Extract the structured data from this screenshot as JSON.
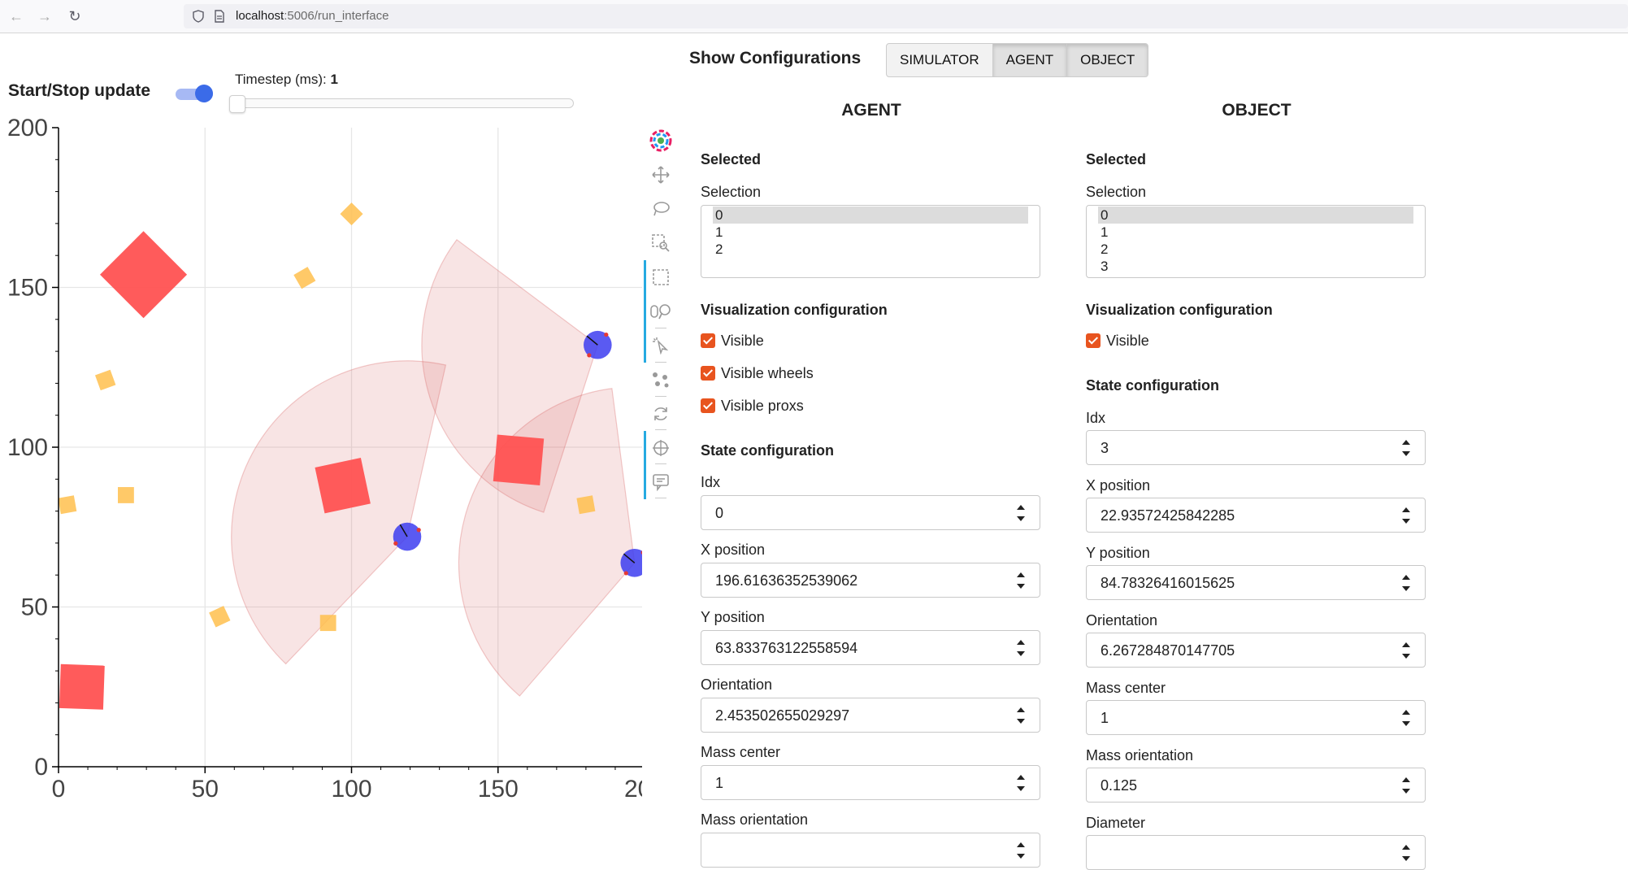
{
  "browser": {
    "url_host": "localhost",
    "url_path": ":5006/run_interface"
  },
  "controls": {
    "toggle_label": "Start/Stop update",
    "toggle_on": true,
    "timestep_label": "Timestep (ms): ",
    "timestep_value": "1",
    "timestep_slider_fraction": 0
  },
  "plot": {
    "x_ticks": [
      "0",
      "50",
      "100",
      "150",
      "200"
    ],
    "y_ticks": [
      "0",
      "50",
      "100",
      "150",
      "200"
    ],
    "xlim": [
      0,
      200
    ],
    "ylim": [
      0,
      200
    ],
    "grid": true,
    "colors": {
      "object": "#ff5252",
      "resource": "#ffc04d",
      "agent": "#3d3df0",
      "prox": "#d96b6b"
    },
    "objects": [
      {
        "x": 29,
        "y": 154,
        "size": 21,
        "angle": 45
      },
      {
        "x": 97,
        "y": 88,
        "size": 16,
        "angle": 12
      },
      {
        "x": 157,
        "y": 96,
        "size": 16,
        "angle": -5
      },
      {
        "x": 8,
        "y": 25,
        "size": 15,
        "angle": -2
      }
    ],
    "resources": [
      {
        "x": 100,
        "y": 173,
        "angle": 45
      },
      {
        "x": 84,
        "y": 153,
        "angle": 30
      },
      {
        "x": 16,
        "y": 121,
        "angle": 20
      },
      {
        "x": 3,
        "y": 82,
        "angle": 10
      },
      {
        "x": 23,
        "y": 85,
        "angle": 0
      },
      {
        "x": 55,
        "y": 47,
        "angle": 25
      },
      {
        "x": 92,
        "y": 45,
        "angle": 0
      },
      {
        "x": 180,
        "y": 82,
        "angle": 10
      }
    ],
    "agents": [
      {
        "x": 119,
        "y": 72,
        "orientation": 2.1,
        "fov": [
          1.35,
          3.95
        ]
      },
      {
        "x": 184,
        "y": 132,
        "orientation": 2.45,
        "fov": [
          2.5,
          4.4
        ]
      },
      {
        "x": 196.6,
        "y": 63.8,
        "orientation": 2.45,
        "fov": [
          1.7,
          4.0
        ]
      }
    ]
  },
  "toolbar": {
    "tools": [
      "bokeh-logo-icon",
      "pan-icon",
      "lasso-select-icon",
      "box-zoom-icon",
      "box-select-icon",
      "wheel-zoom-icon",
      "tap-icon",
      "point-draw-icon",
      "reset-icon",
      "crosshair-icon",
      "hover-icon"
    ]
  },
  "config": {
    "title": "Show Configurations",
    "buttons": [
      {
        "label": "SIMULATOR",
        "active": false
      },
      {
        "label": "AGENT",
        "active": true
      },
      {
        "label": "OBJECT",
        "active": true
      }
    ]
  },
  "agent_panel": {
    "heading": "AGENT",
    "selected_title": "Selected",
    "selection_label": "Selection",
    "selection_options": [
      "0",
      "1",
      "2"
    ],
    "selected_index": 0,
    "vis_title": "Visualization configuration",
    "checks": [
      {
        "label": "Visible",
        "checked": true
      },
      {
        "label": "Visible wheels",
        "checked": true
      },
      {
        "label": "Visible proxs",
        "checked": true
      }
    ],
    "state_title": "State configuration",
    "fields": [
      {
        "label": "Idx",
        "value": "0"
      },
      {
        "label": "X position",
        "value": "196.61636352539062"
      },
      {
        "label": "Y position",
        "value": "63.833763122558594"
      },
      {
        "label": "Orientation",
        "value": "2.453502655029297"
      },
      {
        "label": "Mass center",
        "value": "1"
      },
      {
        "label": "Mass orientation",
        "value": ""
      }
    ]
  },
  "object_panel": {
    "heading": "OBJECT",
    "selected_title": "Selected",
    "selection_label": "Selection",
    "selection_options": [
      "0",
      "1",
      "2",
      "3"
    ],
    "selected_index": 0,
    "vis_title": "Visualization configuration",
    "checks": [
      {
        "label": "Visible",
        "checked": true
      }
    ],
    "state_title": "State configuration",
    "fields": [
      {
        "label": "Idx",
        "value": "3"
      },
      {
        "label": "X position",
        "value": "22.93572425842285"
      },
      {
        "label": "Y position",
        "value": "84.78326416015625"
      },
      {
        "label": "Orientation",
        "value": "6.267284870147705"
      },
      {
        "label": "Mass center",
        "value": "1"
      },
      {
        "label": "Mass orientation",
        "value": "0.125"
      },
      {
        "label": "Diameter",
        "value": ""
      }
    ]
  }
}
